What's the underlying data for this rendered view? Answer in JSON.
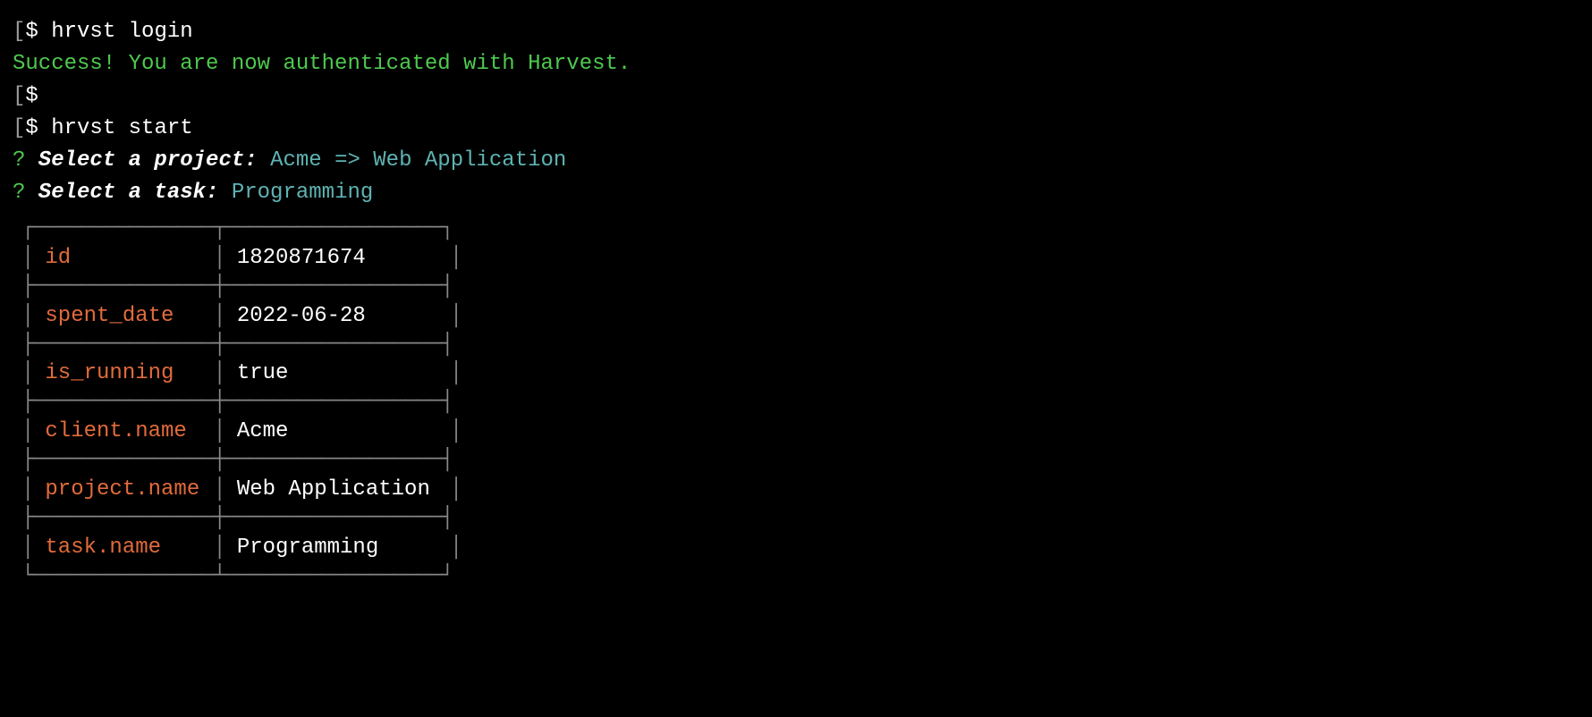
{
  "lines": {
    "prompt_bracket": "[",
    "prompt_symbol": "$ ",
    "login_cmd": "hrvst login",
    "success_msg": "Success! You are now authenticated with Harvest.",
    "start_cmd": "hrvst start",
    "question_mark": "?",
    "select_project_label": " Select a project: ",
    "select_project_value": "Acme => Web Application",
    "select_task_label": " Select a task: ",
    "select_task_value": "Programming"
  },
  "table": {
    "rows": [
      {
        "key": "id",
        "value": "1820871674"
      },
      {
        "key": "spent_date",
        "value": "2022-06-28"
      },
      {
        "key": "is_running",
        "value": "true"
      },
      {
        "key": "client.name",
        "value": "Acme"
      },
      {
        "key": "project.name",
        "value": "Web Application"
      },
      {
        "key": "task.name",
        "value": "Programming"
      }
    ]
  },
  "table_border": {
    "top": "┌───────────────┬──────────────────┐",
    "mid": "├───────────────┼──────────────────┤",
    "bottom": "└───────────────┴──────────────────┘",
    "pipe": "│"
  }
}
